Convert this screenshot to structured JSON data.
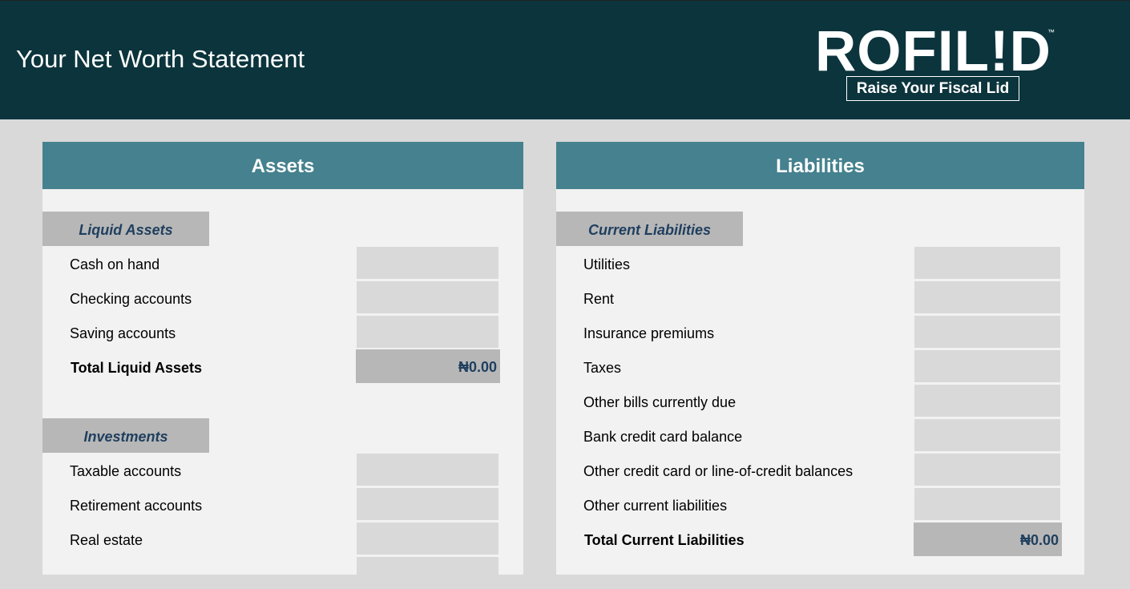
{
  "header": {
    "title": "Your Net Worth Statement",
    "logo_word": "ROFIL!D",
    "logo_tm": "™",
    "logo_tagline": "Raise Your Fiscal Lid"
  },
  "assets": {
    "heading": "Assets",
    "liquid": {
      "title": "Liquid Assets",
      "rows": [
        "Cash on hand",
        "Checking accounts",
        "Saving accounts"
      ],
      "total_label": "Total Liquid Assets",
      "total_value": "₦0.00"
    },
    "investments": {
      "title": "Investments",
      "rows": [
        "Taxable accounts",
        "Retirement accounts",
        "Real estate"
      ]
    }
  },
  "liabilities": {
    "heading": "Liabilities",
    "current": {
      "title": "Current Liabilities",
      "rows": [
        "Utilities",
        "Rent",
        "Insurance premiums",
        "Taxes",
        "Other bills currently due",
        "Bank credit card balance",
        "Other credit card or line-of-credit balances",
        "Other current liabilities"
      ],
      "total_label": "Total Current Liabilities",
      "total_value": "₦0.00"
    }
  },
  "colors": {
    "header_bg": "#0c343d",
    "panel_head": "#45818e",
    "section_tag": "#b7b7b7",
    "input_cell": "#d9d9d9",
    "accent_text": "#1f3f5f"
  }
}
